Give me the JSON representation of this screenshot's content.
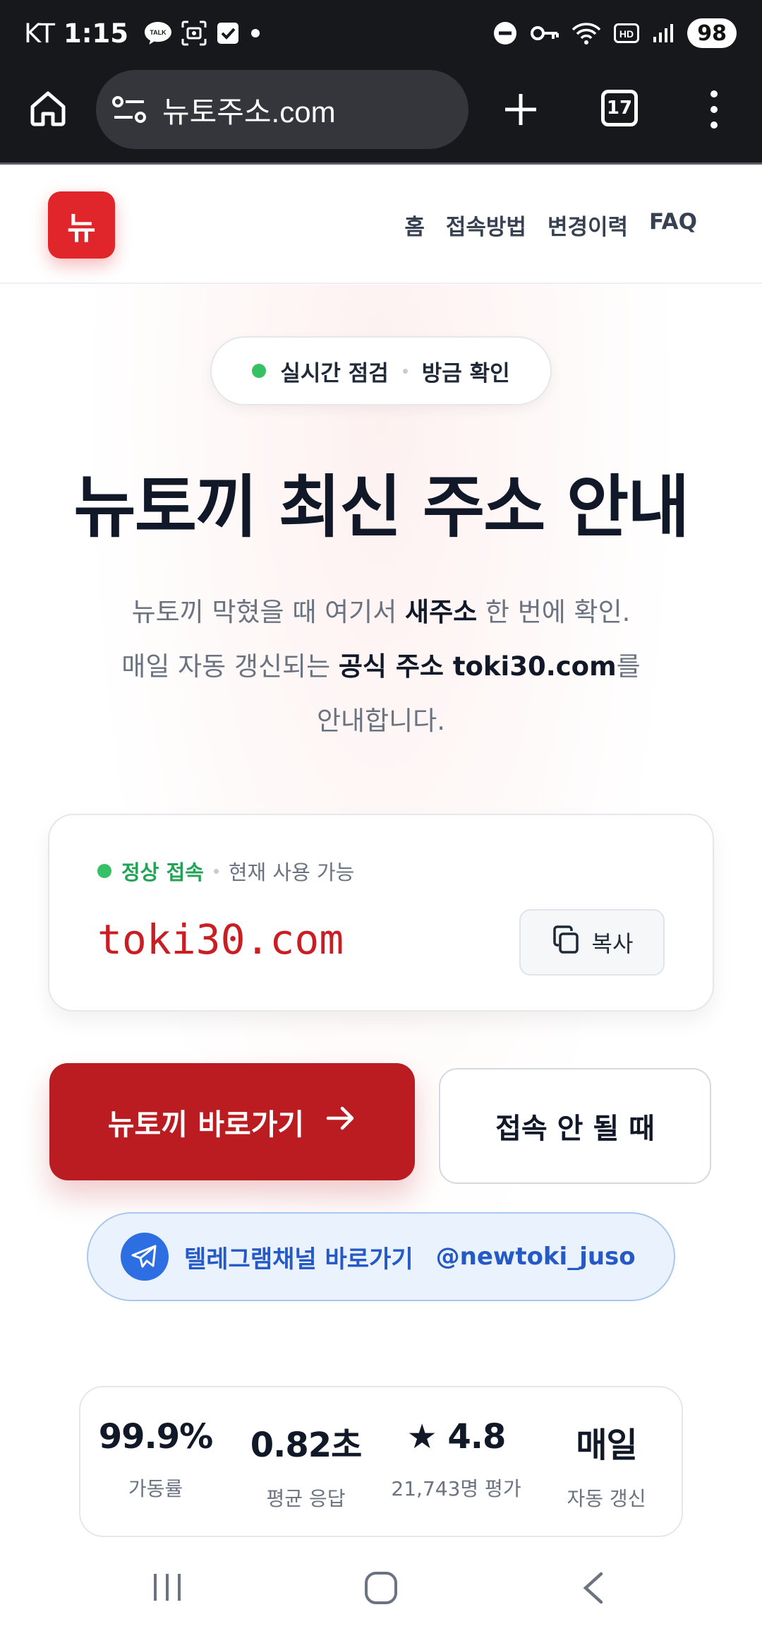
{
  "status_bar": {
    "carrier": "KT",
    "time": "1:15",
    "talk_badge": "TALK",
    "battery": "98",
    "hd_label": "HD"
  },
  "browser": {
    "url": "뉴토주소.com",
    "tab_count": "17"
  },
  "site": {
    "logo": "뉴",
    "nav": [
      "홈",
      "접속방법",
      "변경이력",
      "FAQ"
    ]
  },
  "hero": {
    "pill_left": "실시간 점검",
    "pill_right": "방금 확인",
    "title": "뉴토끼 최신 주소 안내",
    "desc_l1_a": "뉴토끼 막혔을 때 여기서 ",
    "desc_l1_b": "새주소",
    "desc_l1_c": " 한 번에 확인.",
    "desc_l2_a": "매일 자동 갱신되는 ",
    "desc_l2_b": "공식 주소 toki30.com",
    "desc_l2_c": "를",
    "desc_l3": "안내합니다."
  },
  "address_card": {
    "status": "정상 접속",
    "availability": "현재 사용 가능",
    "domain": "toki30.com",
    "copy_label": "복사"
  },
  "cta": {
    "primary": "뉴토끼 바로가기",
    "secondary": "접속 안 될 때"
  },
  "telegram": {
    "label": "텔레그램채널 바로가기",
    "handle": "@newtoki_juso"
  },
  "stats": [
    {
      "value": "99.9%",
      "label": "가동률"
    },
    {
      "value": "0.82초",
      "label": "평균 응답"
    },
    {
      "value": "★ 4.8",
      "label": "21,743명 평가"
    },
    {
      "value": "매일",
      "label": "자동 갱신"
    }
  ],
  "colors": {
    "brand_red": "#ba1c21",
    "logo_red": "#e0262b",
    "domain_red": "#c81e24",
    "status_green": "#22a356",
    "telegram_blue": "#2459c6"
  }
}
